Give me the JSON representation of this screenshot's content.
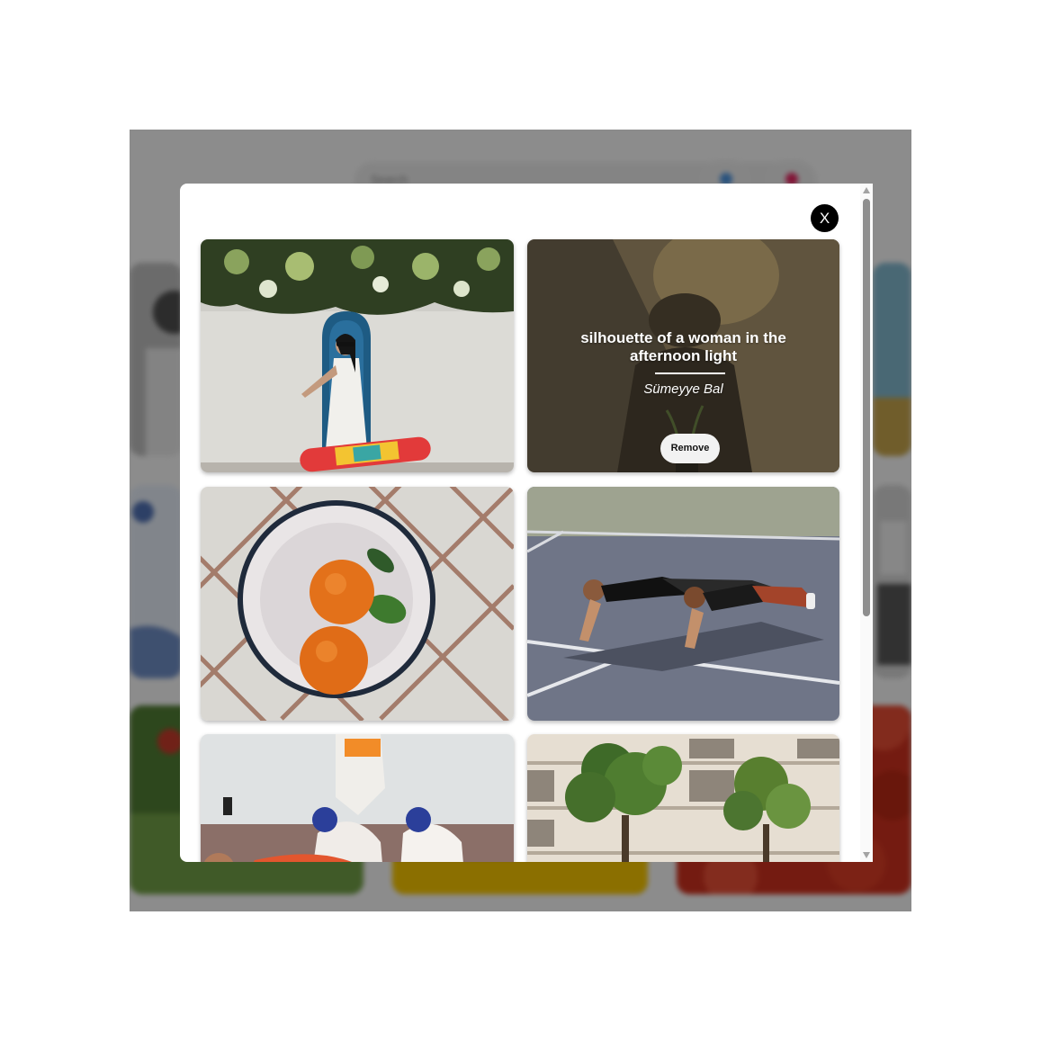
{
  "background_page": {
    "search_placeholder": "Search",
    "accent_colors": [
      "#4a90d9",
      "#e0245e"
    ]
  },
  "modal": {
    "close_label": "X",
    "images": [
      {
        "id": "skateboard-woman"
      },
      {
        "id": "silhouette",
        "title": "silhouette of a woman in the afternoon light",
        "author": "Sümeyye Bal",
        "remove_label": "Remove"
      },
      {
        "id": "tangerines-bowl"
      },
      {
        "id": "women-plank"
      },
      {
        "id": "festival-horses"
      },
      {
        "id": "building-trees"
      }
    ]
  }
}
